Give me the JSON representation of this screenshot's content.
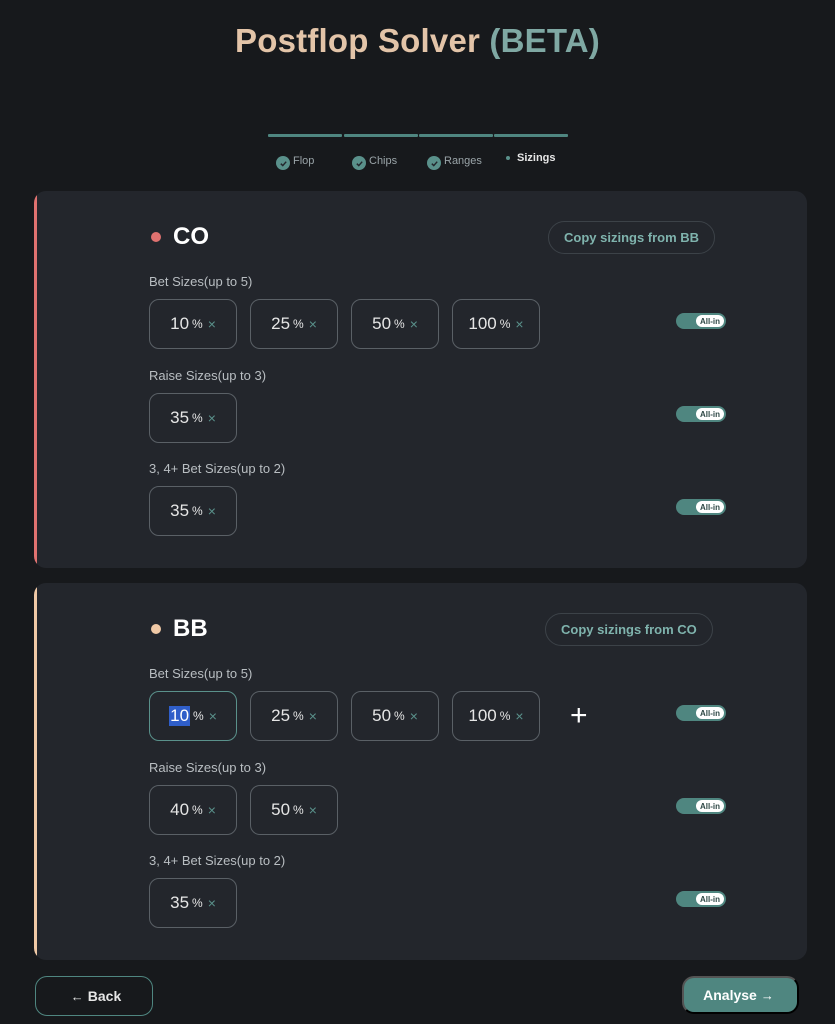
{
  "title": {
    "part1": "Postflop Solver ",
    "part2": "(BETA)"
  },
  "steps": [
    {
      "label": "Flop",
      "done": true
    },
    {
      "label": "Chips",
      "done": true
    },
    {
      "label": "Ranges",
      "done": true
    },
    {
      "label": "Sizings",
      "done": false
    }
  ],
  "colors": {
    "co_accent": "#e07270",
    "bb_accent": "#f0c9a6",
    "teal": "#4f8680"
  },
  "co": {
    "name": "CO",
    "copy_label": "Copy sizings from BB",
    "bet_label": "Bet Sizes(up to 5)",
    "bet_values": [
      "10",
      "25",
      "50",
      "100"
    ],
    "raise_label": "Raise Sizes(up to 3)",
    "raise_values": [
      "35"
    ],
    "threebet_label": "3, 4+ Bet Sizes(up to 2)",
    "threebet_values": [
      "35"
    ]
  },
  "bb": {
    "name": "BB",
    "copy_label": "Copy sizings from CO",
    "bet_label": "Bet Sizes(up to 5)",
    "bet_values": [
      "10",
      "25",
      "50",
      "100"
    ],
    "raise_label": "Raise Sizes(up to 3)",
    "raise_values": [
      "40",
      "50"
    ],
    "threebet_label": "3, 4+ Bet Sizes(up to 2)",
    "threebet_values": [
      "35"
    ]
  },
  "common": {
    "percent": "%",
    "remove": "×",
    "add": "+",
    "allin": "All-in"
  },
  "nav": {
    "back_label": "Back",
    "back_arrow": "←",
    "analyse_label": "Analyse",
    "analyse_arrow": "→"
  }
}
